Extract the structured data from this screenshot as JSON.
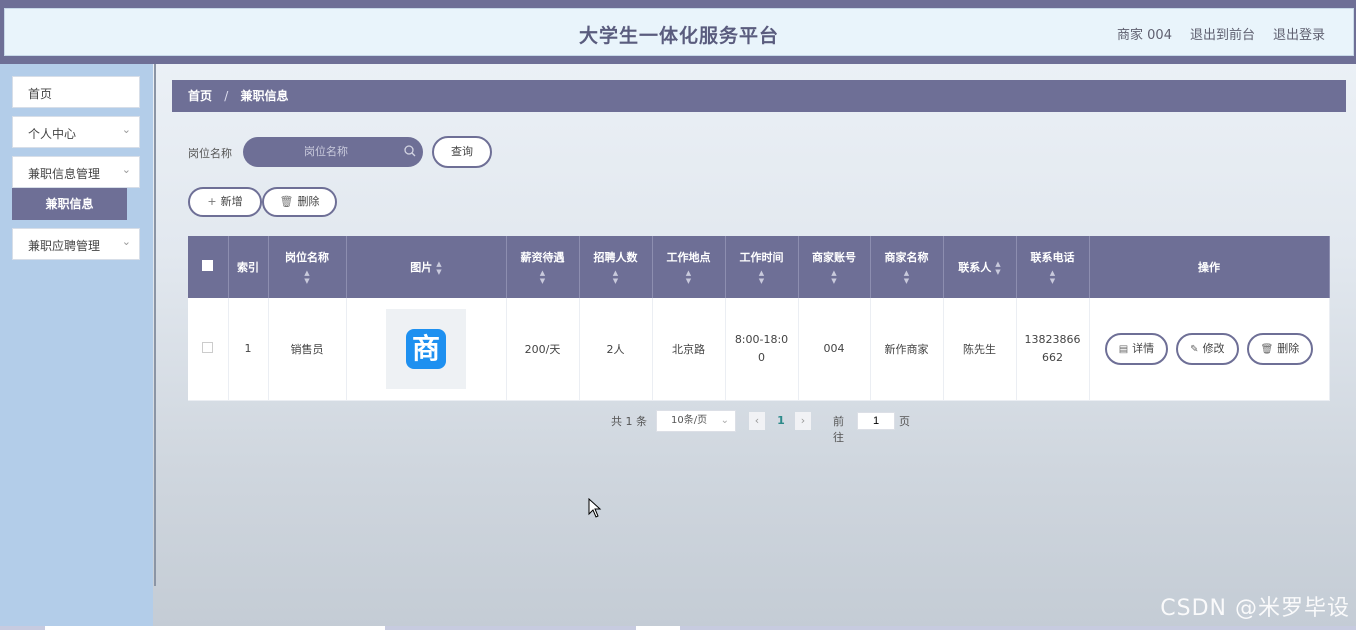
{
  "header": {
    "title": "大学生一体化服务平台",
    "user": "商家 004",
    "front": "退出到前台",
    "logout": "退出登录"
  },
  "sidebar": {
    "items": [
      {
        "label": "首页"
      },
      {
        "label": "个人中心"
      },
      {
        "label": "兼职信息管理"
      },
      {
        "label": "兼职应聘管理"
      }
    ],
    "active_sub": "兼职信息"
  },
  "breadcrumb": {
    "home": "首页",
    "sep": "/",
    "current": "兼职信息"
  },
  "search": {
    "label": "岗位名称",
    "placeholder": "岗位名称",
    "button": "查询"
  },
  "actions": {
    "add": "新增",
    "delete": "删除"
  },
  "table": {
    "columns": [
      "索引",
      "岗位名称",
      "图片",
      "薪资待遇",
      "招聘人数",
      "工作地点",
      "工作时间",
      "商家账号",
      "商家名称",
      "联系人",
      "联系电话",
      "操作"
    ],
    "rows": [
      {
        "index": "1",
        "position": "销售员",
        "image_text": "商",
        "salary": "200/天",
        "headcount": "2人",
        "location": "北京路",
        "time": "8:00-18:00",
        "merchant_account": "004",
        "merchant_name": "新作商家",
        "contact": "陈先生",
        "phone": "13823866662"
      }
    ],
    "ops": {
      "detail": "详情",
      "edit": "修改",
      "delete": "删除"
    }
  },
  "pagination": {
    "total": "共 1 条",
    "page_size": "10条/页",
    "current": "1",
    "goto": "前往",
    "goto_value": "1",
    "unit": "页"
  },
  "watermark": "CSDN @米罗毕设",
  "colors": {
    "primary": "#6e6f96",
    "sidebar": "#b3cde9",
    "header_bg": "#e9f4fb"
  }
}
